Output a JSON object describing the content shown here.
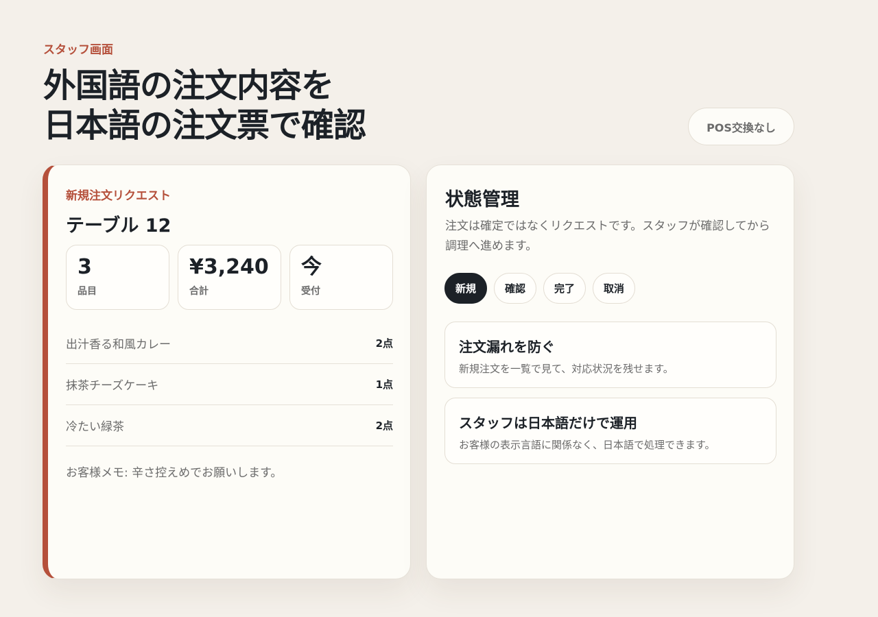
{
  "header": {
    "eyebrow": "スタッフ画面",
    "title_line1": "外国語の注文内容を",
    "title_line2": "日本語の注文票で確認",
    "pos_badge": "POS交換なし"
  },
  "order_card": {
    "label": "新規注文リクエスト",
    "table": "テーブル 12",
    "stats": [
      {
        "value": "3",
        "label": "品目"
      },
      {
        "value": "¥3,240",
        "label": "合計"
      },
      {
        "value": "今",
        "label": "受付"
      }
    ],
    "items": [
      {
        "name": "出汁香る和風カレー",
        "qty": "2点"
      },
      {
        "name": "抹茶チーズケーキ",
        "qty": "1点"
      },
      {
        "name": "冷たい緑茶",
        "qty": "2点"
      }
    ],
    "memo": "お客様メモ: 辛さ控えめでお願いします。"
  },
  "status_card": {
    "title": "状態管理",
    "description": "注文は確定ではなくリクエストです。スタッフが確認してから調理へ進めます。",
    "statuses": [
      "新規",
      "確認",
      "完了",
      "取消"
    ],
    "active_status": "新規",
    "features": [
      {
        "title": "注文漏れを防ぐ",
        "desc": "新規注文を一覧で見て、対応状況を残せます。"
      },
      {
        "title": "スタッフは日本語だけで運用",
        "desc": "お客様の表示言語に関係なく、日本語で処理できます。"
      }
    ]
  },
  "colors": {
    "accent": "#b5503b",
    "background": "#f4f0ea",
    "card": "#fdfcf7",
    "dark": "#1c2127"
  }
}
